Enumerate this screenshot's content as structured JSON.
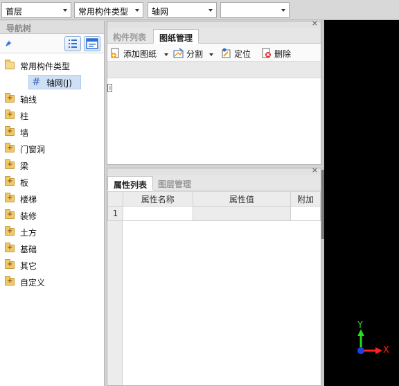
{
  "toolbar": {
    "floor": "首层",
    "component_type": "常用构件类型",
    "component": "轴网",
    "extra": ""
  },
  "nav": {
    "title": "导航树",
    "root": {
      "label": "常用构件类型",
      "child": "轴网(J)"
    },
    "items": [
      "轴线",
      "柱",
      "墙",
      "门窗洞",
      "梁",
      "板",
      "楼梯",
      "装修",
      "土方",
      "基础",
      "其它",
      "自定义"
    ]
  },
  "drawing_panel": {
    "tabs": [
      "构件列表",
      "图纸管理"
    ],
    "active_tab": "图纸管理",
    "tools": {
      "add": "添加图纸",
      "split": "分割",
      "locate": "定位",
      "delete": "删除"
    }
  },
  "property_panel": {
    "tabs": [
      "属性列表",
      "图层管理"
    ],
    "active_tab": "属性列表",
    "columns": [
      "属性名称",
      "属性值",
      "附加"
    ],
    "rows": [
      {
        "index": "1",
        "name": "",
        "value": "",
        "extra": ""
      }
    ]
  },
  "axes": {
    "x_label": "X",
    "y_label": "Y",
    "x_color": "#ff2020",
    "y_color": "#20e020"
  }
}
